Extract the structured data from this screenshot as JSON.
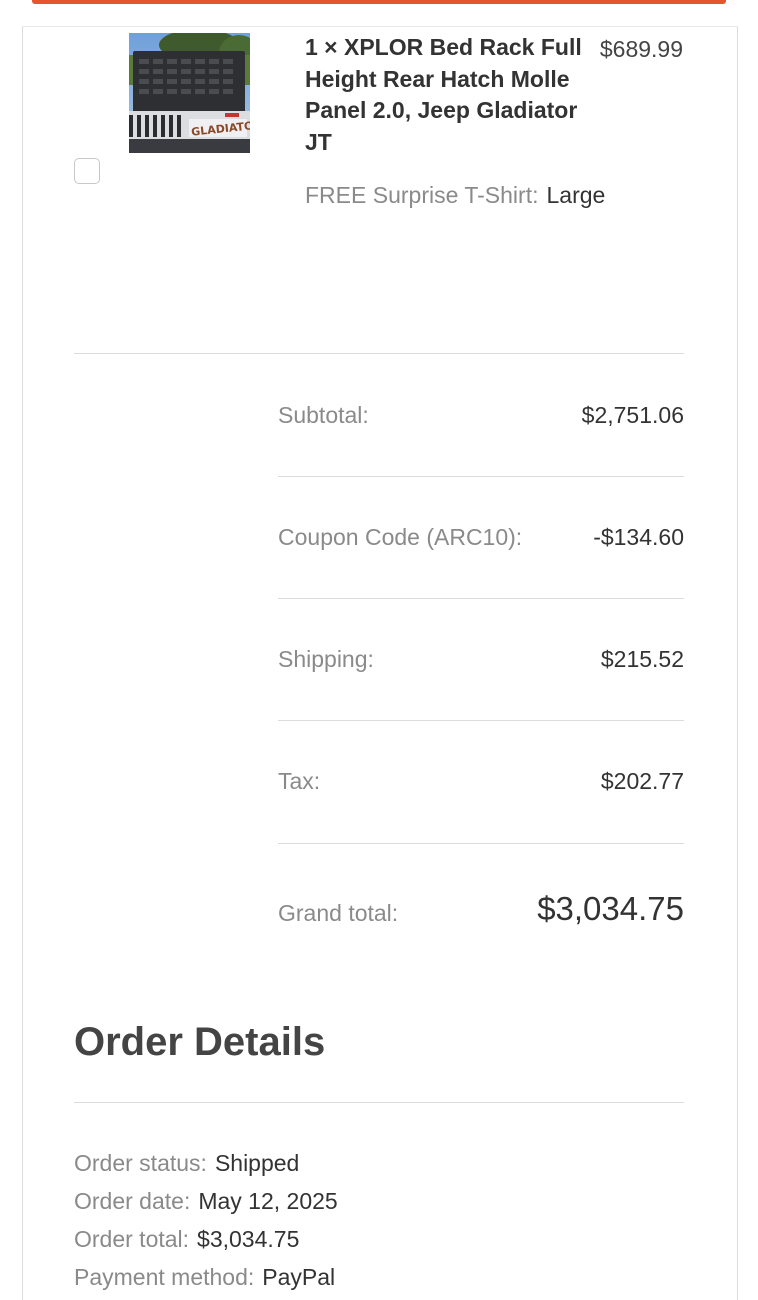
{
  "product": {
    "title": "1 × XPLOR Bed Rack Full Height Rear Hatch Molle Panel 2.0, Jeep Gladiator JT",
    "price": "$689.99",
    "option_label": "FREE Surprise T-Shirt:",
    "option_value": "Large",
    "image_logo_text": "GLADIATOR"
  },
  "totals": {
    "subtotal_label": "Subtotal:",
    "subtotal_value": "$2,751.06",
    "coupon_label": "Coupon Code (ARC10):",
    "coupon_value": "-$134.60",
    "shipping_label": "Shipping:",
    "shipping_value": "$215.52",
    "tax_label": "Tax:",
    "tax_value": "$202.77",
    "grand_label": "Grand total:",
    "grand_value": "$3,034.75"
  },
  "order_details": {
    "title": "Order Details",
    "status_label": "Order status:",
    "status_value": "Shipped",
    "date_label": "Order date:",
    "date_value": "May 12, 2025",
    "total_label": "Order total:",
    "total_value": "$3,034.75",
    "payment_label": "Payment method:",
    "payment_value": "PayPal"
  },
  "colors": {
    "accent": "#e4572e",
    "label": "#8a8a8a",
    "text": "#333333",
    "divider": "#dcdcdc"
  }
}
